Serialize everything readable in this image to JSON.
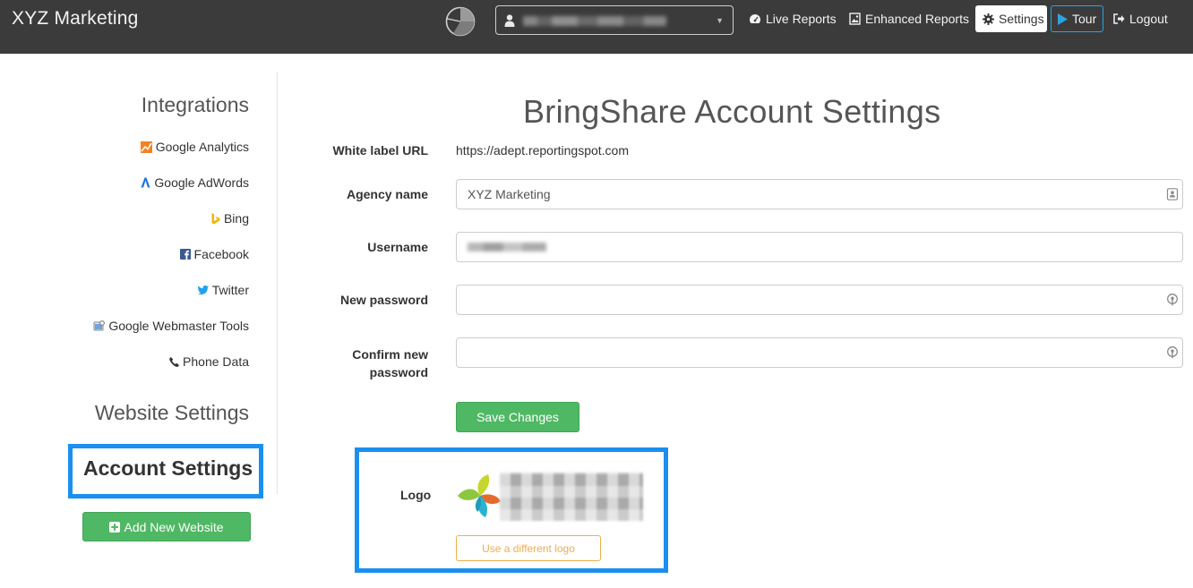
{
  "topbar": {
    "brand": "XYZ Marketing",
    "app_logo_icon": "pie-chart-icon",
    "site_select": {
      "user_icon": "user-icon",
      "selected_value": "(blurred)",
      "chevron_icon": "chevron-down-icon"
    },
    "nav": {
      "live_reports": "Live Reports",
      "enhanced_reports": "Enhanced Reports",
      "settings": "Settings",
      "tour": "Tour",
      "logout": "Logout"
    },
    "tour_accent": "#2ea2dc"
  },
  "sidebar": {
    "integrations_heading": "Integrations",
    "items": [
      {
        "label": "Google Analytics",
        "icon": "google-analytics-icon"
      },
      {
        "label": "Google AdWords",
        "icon": "google-adwords-icon"
      },
      {
        "label": "Bing",
        "icon": "bing-icon"
      },
      {
        "label": "Facebook",
        "icon": "facebook-icon"
      },
      {
        "label": "Twitter",
        "icon": "twitter-icon"
      },
      {
        "label": "Google Webmaster Tools",
        "icon": "webmaster-tools-icon"
      },
      {
        "label": "Phone Data",
        "icon": "phone-icon"
      }
    ],
    "website_settings": "Website Settings",
    "account_settings": "Account Settings",
    "add_website": "Add New Website",
    "highlight_color": "#1b8ff0",
    "button_color": "#4fb864"
  },
  "main": {
    "title": "BringShare Account Settings",
    "white_label_url": {
      "label": "White label URL",
      "value": "https://adept.reportingspot.com"
    },
    "agency_name": {
      "label": "Agency name",
      "value": "XYZ Marketing"
    },
    "username": {
      "label": "Username",
      "value": "(blurred)"
    },
    "new_password": {
      "label": "New password",
      "value": ""
    },
    "confirm_password": {
      "label_line1": "Confirm new",
      "label_line2": "password",
      "value": ""
    },
    "save_button": "Save Changes",
    "logo": {
      "label": "Logo",
      "change_button": "Use a different logo"
    },
    "change_button_color": "#f0ad4e"
  }
}
